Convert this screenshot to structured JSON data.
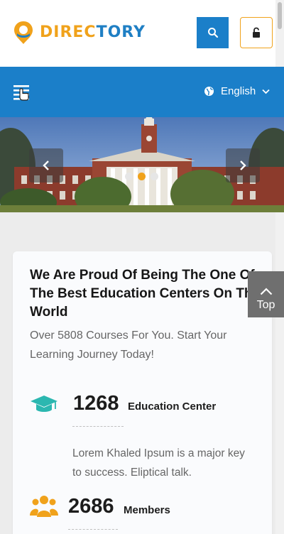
{
  "header": {
    "logo_part1": "DIREC",
    "logo_part2": "TORY",
    "search_icon": "search-icon",
    "lock_icon": "lock-icon"
  },
  "navbar": {
    "menu_icon": "menu-icon",
    "language": "English",
    "globe_icon": "globe-icon",
    "chevron_icon": "chevron-down-icon"
  },
  "slider": {
    "prev_icon": "chevron-left-icon",
    "next_icon": "chevron-right-icon",
    "dots": 3,
    "active_dot": 2
  },
  "intro": {
    "title": "We Are Proud Of Being The One Of The Best Education Centers On The World",
    "subtitle": "Over 5808 Courses For You. Start Your Learning Journey Today!"
  },
  "stats": [
    {
      "icon": "graduation-cap-icon",
      "value": "1268",
      "label": "Education Center",
      "description": "Lorem Khaled Ipsum is a major key to success. Eliptical talk."
    },
    {
      "icon": "users-icon",
      "value": "2686",
      "label": "Members"
    }
  ],
  "back_to_top": {
    "label": "Top",
    "icon": "chevron-up-icon"
  },
  "colors": {
    "brand_blue": "#1b7fc9",
    "brand_orange": "#f0a21b",
    "teal": "#2bb7b0"
  }
}
